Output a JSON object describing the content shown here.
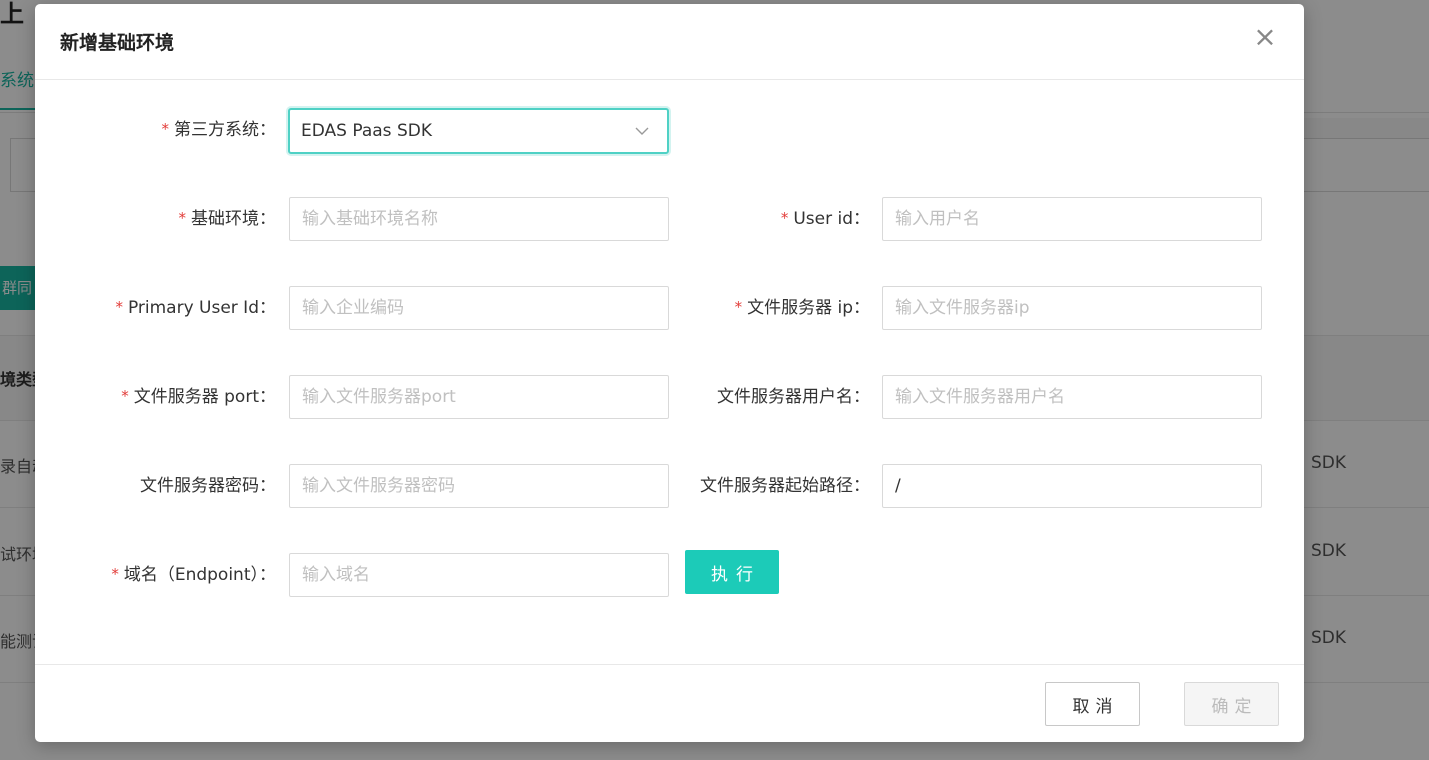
{
  "background": {
    "page_title_fragment": "上",
    "tab_fragment": "系统",
    "green_button_fragment": "群同",
    "column_header_fragment": "境类型",
    "rows": [
      {
        "left": "录自动",
        "right": "SDK"
      },
      {
        "left": "试环境",
        "right": "SDK"
      },
      {
        "left": "能测试",
        "right": "SDK"
      }
    ]
  },
  "modal": {
    "title": "新增基础环境",
    "close_icon": "close-icon",
    "fields": {
      "third_party_system": {
        "label": "第三方系统：",
        "value": "EDAS Paas SDK",
        "required": true
      },
      "base_env": {
        "label": "基础环境：",
        "placeholder": "输入基础环境名称",
        "value": "",
        "required": true
      },
      "user_id": {
        "label": "User id：",
        "placeholder": "输入用户名",
        "value": "",
        "required": true
      },
      "primary_user_id": {
        "label": "Primary User Id：",
        "placeholder": "输入企业编码",
        "value": "",
        "required": true
      },
      "file_server_ip": {
        "label": "文件服务器 ip：",
        "placeholder": "输入文件服务器ip",
        "value": "",
        "required": true
      },
      "file_server_port": {
        "label": "文件服务器 port：",
        "placeholder": "输入文件服务器port",
        "value": "",
        "required": true
      },
      "file_server_username": {
        "label": "文件服务器用户名：",
        "placeholder": "输入文件服务器用户名",
        "value": "",
        "required": false
      },
      "file_server_password": {
        "label": "文件服务器密码：",
        "placeholder": "输入文件服务器密码",
        "value": "",
        "required": false
      },
      "file_server_start_path": {
        "label": "文件服务器起始路径：",
        "placeholder": "",
        "value": "/",
        "required": false
      },
      "endpoint": {
        "label": "域名（Endpoint）：",
        "placeholder": "输入域名",
        "value": "",
        "required": true
      }
    },
    "execute_label": "执行",
    "cancel_label": "取消",
    "confirm_label": "确定",
    "required_mark": "*"
  },
  "colors": {
    "accent": "#1ccbb8",
    "focus_border": "#4fd1c5",
    "required": "#e23c39"
  }
}
